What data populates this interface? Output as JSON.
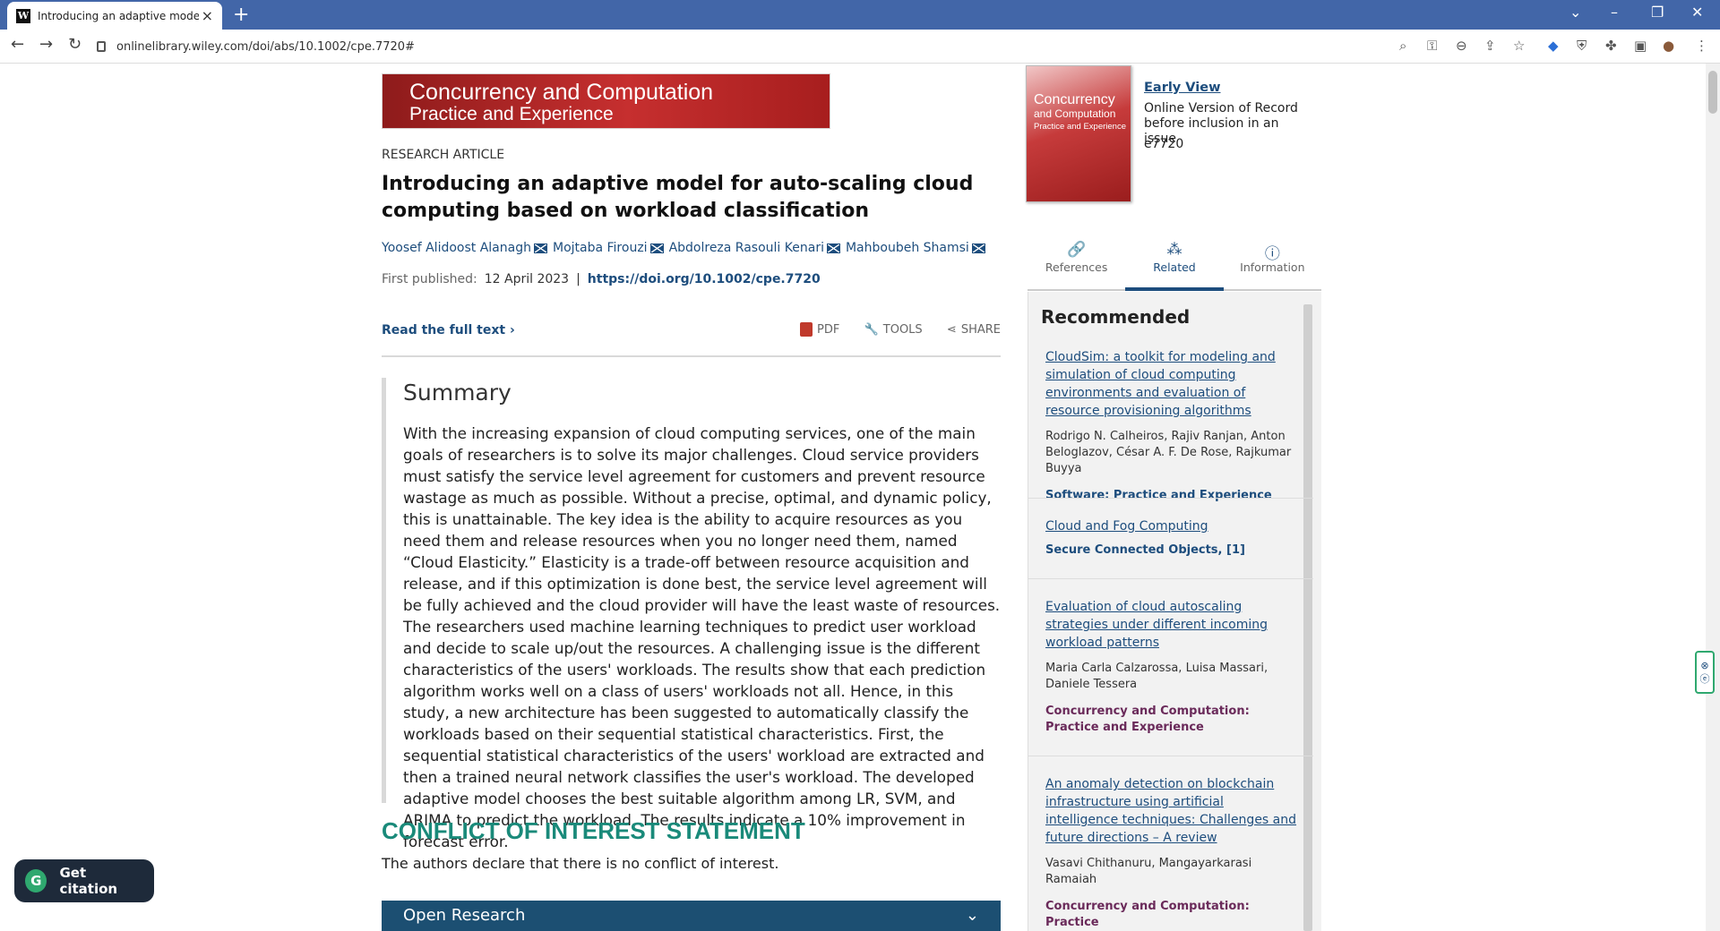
{
  "browser": {
    "tab_favicon": "W",
    "tab_title": "Introducing an adaptive model fo",
    "url": "onlinelibrary.wiley.com/doi/abs/10.1002/cpe.7720#"
  },
  "banner": {
    "line1": "Concurrency and Computation",
    "line2": "Practice and Experience"
  },
  "article": {
    "type": "RESEARCH ARTICLE",
    "title": "Introducing an adaptive model for auto-scaling cloud computing based on workload classification",
    "authors": [
      "Yoosef Alidoost Alanagh",
      "Mojtaba Firouzi",
      "Abdolreza Rasouli Kenari",
      "Mahboubeh Shamsi"
    ],
    "first_published_label": "First published:",
    "first_published_date": "12 April 2023",
    "separator": "|",
    "doi": "https://doi.org/10.1002/cpe.7720",
    "read_full": "Read the full text",
    "pdf_label": "PDF",
    "tools_label": "TOOLS",
    "share_label": "SHARE",
    "summary_heading": "Summary",
    "summary_text": "With the increasing expansion of cloud computing services, one of the main goals of researchers is to solve its major challenges. Cloud service providers must satisfy the service level agreement for customers and prevent resource wastage as much as possible. Without a precise, optimal, and dynamic policy, this is unattainable. The key idea is the ability to acquire resources as you need them and release resources when you no longer need them, named “Cloud Elasticity.” Elasticity is a trade-off between resource acquisition and release, and if this optimization is done best, the service level agreement will be fully achieved and the cloud provider will have the least waste of resources. The researchers used machine learning techniques to predict user workload and decide to scale up/out the resources. A challenging issue is the different characteristics of the users' workloads. The results show that each prediction algorithm works well on a class of users' workloads not all. Hence, in this study, a new architecture has been suggested to automatically classify the workloads based on their sequential statistical characteristics. First, the sequential statistical characteristics of the users' workload are extracted and then a trained neural network classifies the user's workload. The developed adaptive model chooses the best suitable algorithm among LR, SVM, and ARIMA to predict the workload. The results indicate a 10% improvement in forecast error.",
    "coi_heading": "CONFLICT OF INTEREST STATEMENT",
    "coi_text": "The authors declare that there is no conflict of interest.",
    "open_research": "Open Research"
  },
  "citation_button": "Get citation",
  "journal_cover": {
    "title_line1": "Concurrency",
    "title_line2": "and Computation",
    "subtitle": "Practice and Experience"
  },
  "early_view": {
    "link": "Early View",
    "subtitle": "Online Version of Record before inclusion in an issue",
    "id": "e7720"
  },
  "side_tabs": [
    {
      "label": "References",
      "icon": "link-icon"
    },
    {
      "label": "Related",
      "icon": "related-icon"
    },
    {
      "label": "Information",
      "icon": "info-icon"
    }
  ],
  "recommended": {
    "heading": "Recommended",
    "items": [
      {
        "title": "CloudSim: a toolkit for modeling and simulation of cloud computing environments and evaluation of resource provisioning algorithms",
        "authors": "Rodrigo N. Calheiros, Rajiv Ranjan, Anton Beloglazov, César A. F. De Rose, Rajkumar Buyya",
        "journal": "Software: Practice and Experience"
      },
      {
        "title": "Cloud and Fog Computing",
        "authors": "",
        "journal": "Secure Connected Objects, [1]"
      },
      {
        "title": "Evaluation of cloud autoscaling strategies under different incoming workload patterns",
        "authors": "Maria Carla Calzarossa, Luisa Massari, Daniele Tessera",
        "journal": "Concurrency and Computation: Practice and Experience"
      },
      {
        "title": "An anomaly detection on blockchain infrastructure using artificial intelligence techniques: Challenges and future directions – A review",
        "authors": "Vasavi Chithanuru, Mangayarkarasi Ramaiah",
        "journal": "Concurrency and Computation: Practice"
      }
    ]
  }
}
